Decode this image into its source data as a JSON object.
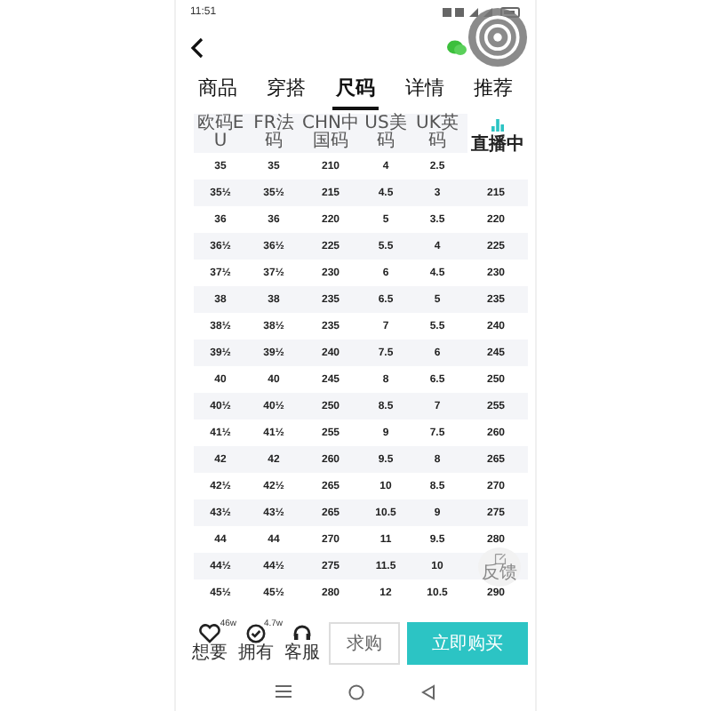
{
  "status_bar": {
    "time": "11:51"
  },
  "tabs": [
    {
      "label": "商品",
      "selected": false
    },
    {
      "label": "穿搭",
      "selected": false
    },
    {
      "label": "尺码",
      "selected": true
    },
    {
      "label": "详情",
      "selected": false
    },
    {
      "label": "推荐",
      "selected": false
    }
  ],
  "table": {
    "columns": [
      "欧码EU",
      "FR法码",
      "CHN中国码",
      "US美码",
      "UK英码"
    ],
    "rows": [
      [
        "35",
        "35",
        "210",
        "4",
        "2.5"
      ],
      [
        "35½",
        "35½",
        "215",
        "4.5",
        "3",
        "215"
      ],
      [
        "36",
        "36",
        "220",
        "5",
        "3.5",
        "220"
      ],
      [
        "36½",
        "36½",
        "225",
        "5.5",
        "4",
        "225"
      ],
      [
        "37½",
        "37½",
        "230",
        "6",
        "4.5",
        "230"
      ],
      [
        "38",
        "38",
        "235",
        "6.5",
        "5",
        "235"
      ],
      [
        "38½",
        "38½",
        "235",
        "7",
        "5.5",
        "240"
      ],
      [
        "39½",
        "39½",
        "240",
        "7.5",
        "6",
        "245"
      ],
      [
        "40",
        "40",
        "245",
        "8",
        "6.5",
        "250"
      ],
      [
        "40½",
        "40½",
        "250",
        "8.5",
        "7",
        "255"
      ],
      [
        "41½",
        "41½",
        "255",
        "9",
        "7.5",
        "260"
      ],
      [
        "42",
        "42",
        "260",
        "9.5",
        "8",
        "265"
      ],
      [
        "42½",
        "42½",
        "265",
        "10",
        "8.5",
        "270"
      ],
      [
        "43½",
        "43½",
        "265",
        "10.5",
        "9",
        "275"
      ],
      [
        "44",
        "44",
        "270",
        "11",
        "9.5",
        "280"
      ],
      [
        "44½",
        "44½",
        "275",
        "11.5",
        "10"
      ],
      [
        "45½",
        "45½",
        "280",
        "12",
        "10.5",
        "290"
      ]
    ]
  },
  "live_badge": "直播中",
  "feedback": "反馈",
  "actions": [
    {
      "kind": "heart",
      "label": "想要",
      "count": "46w"
    },
    {
      "kind": "check",
      "label": "拥有",
      "count": "4.7w"
    },
    {
      "kind": "headset",
      "label": "客服"
    }
  ],
  "buttons": {
    "secondary": "求购",
    "primary": "立即购买"
  }
}
